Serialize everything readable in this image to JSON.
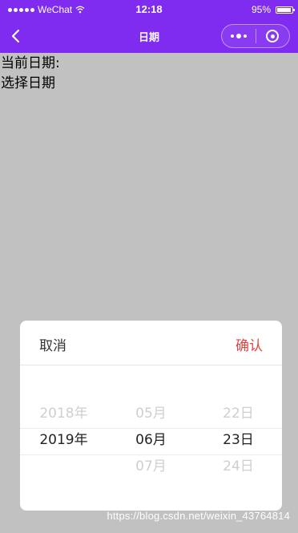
{
  "status_bar": {
    "carrier": "WeChat",
    "time": "12:18",
    "battery": "95%",
    "battery_level": 0.95
  },
  "nav": {
    "title": "日期"
  },
  "content": {
    "current_date_label": "当前日期:",
    "select_date_label": "选择日期"
  },
  "picker": {
    "cancel_label": "取消",
    "confirm_label": "确认",
    "confirm_color": "#e64340",
    "year": {
      "prev": "2018年",
      "selected": "2019年",
      "next": ""
    },
    "month": {
      "prev": "05月",
      "selected": "06月",
      "next": "07月"
    },
    "day": {
      "prev": "22日",
      "selected": "23日",
      "next": "24日"
    }
  },
  "watermark": "https://blog.csdn.net/weixin_43764814",
  "colors": {
    "nav_bg": "#7f2bf0",
    "page_bg": "#c1c1c1"
  }
}
